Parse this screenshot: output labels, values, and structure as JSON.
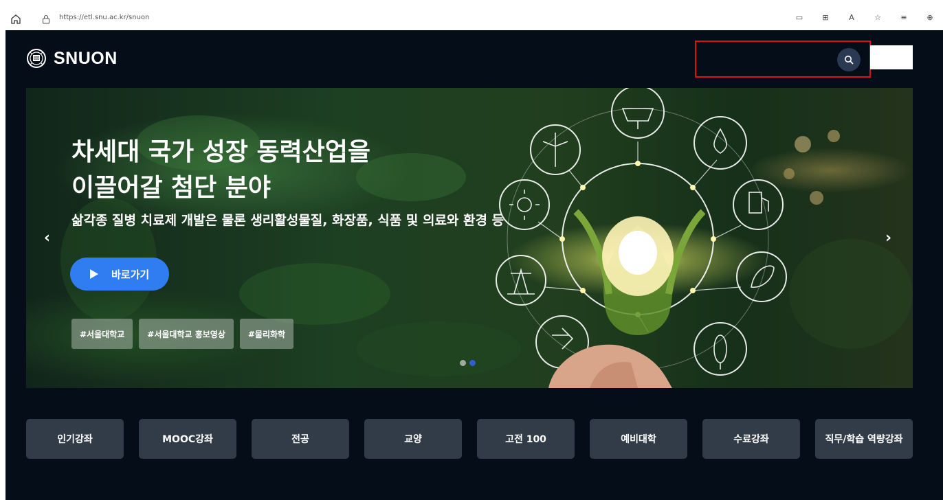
{
  "browser": {
    "url": "https://etl.snu.ac.kr/snuon",
    "right_icons": [
      "reader-icon",
      "grid-icon",
      "read-aloud-icon",
      "favorite-add-icon",
      "favorites-icon",
      "extensions-icon"
    ]
  },
  "header": {
    "logo_text": "SNUON"
  },
  "hero": {
    "title_line1": "차세대 국가 성장 동력산업을",
    "title_line2": "이끌어갈 첨단 분야",
    "subtitle": "삶각종 질병 치료제 개발은 물론 생리활성물질, 화장품, 식품 및 의료와 환경 등",
    "button_label": "바로가기",
    "tags": [
      "#서울대학교",
      "#서울대학교 홍보영상",
      "#물리화학"
    ],
    "prev_arrow": "‹",
    "next_arrow": "›"
  },
  "categories": [
    "인기강좌",
    "MOOC강좌",
    "전공",
    "교양",
    "고전 100",
    "예비대학",
    "수료강좌",
    "직무/학습 역량강좌"
  ],
  "colors": {
    "page_bg": "#050d18",
    "accent_button": "#2f7df0",
    "highlight_border": "#e01010",
    "category_bg": "#323b48"
  }
}
